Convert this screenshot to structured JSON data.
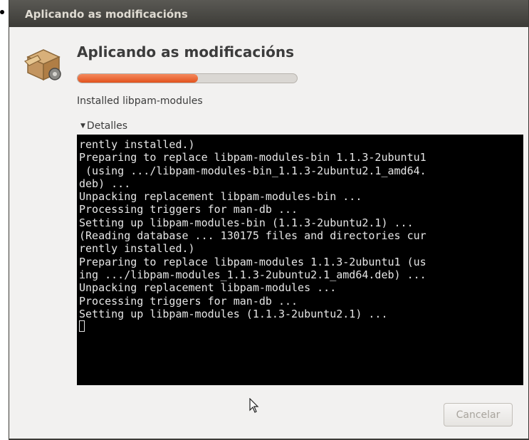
{
  "window": {
    "title": "Aplicando as modificacións"
  },
  "dialog": {
    "heading": "Aplicando as modificacións",
    "progress": 0.55,
    "status": "Installed libpam-modules",
    "details_label": "Detalles",
    "details_expanded": true,
    "terminal_lines": [
      "rently installed.)",
      "Preparing to replace libpam-modules-bin 1.1.3-2ubuntu1",
      " (using .../libpam-modules-bin_1.1.3-2ubuntu2.1_amd64.",
      "deb) ...",
      "Unpacking replacement libpam-modules-bin ...",
      "Processing triggers for man-db ...",
      "Setting up libpam-modules-bin (1.1.3-2ubuntu2.1) ...",
      "(Reading database ... 130175 files and directories cur",
      "rently installed.)",
      "Preparing to replace libpam-modules 1.1.3-2ubuntu1 (us",
      "ing .../libpam-modules_1.1.3-2ubuntu2.1_amd64.deb) ...",
      "Unpacking replacement libpam-modules ...",
      "Processing triggers for man-db ...",
      "Setting up libpam-modules (1.1.3-2ubuntu2.1) ..."
    ],
    "cancel_label": "Cancelar",
    "cancel_enabled": false
  },
  "colors": {
    "titlebar": "#3c3b37",
    "progress_fill": "#e2521d",
    "terminal_bg": "#000000",
    "terminal_fg": "#e6e6e6"
  },
  "icons": {
    "app_icon": "package-box-gear-icon",
    "pointer": "mouse-pointer-icon"
  }
}
